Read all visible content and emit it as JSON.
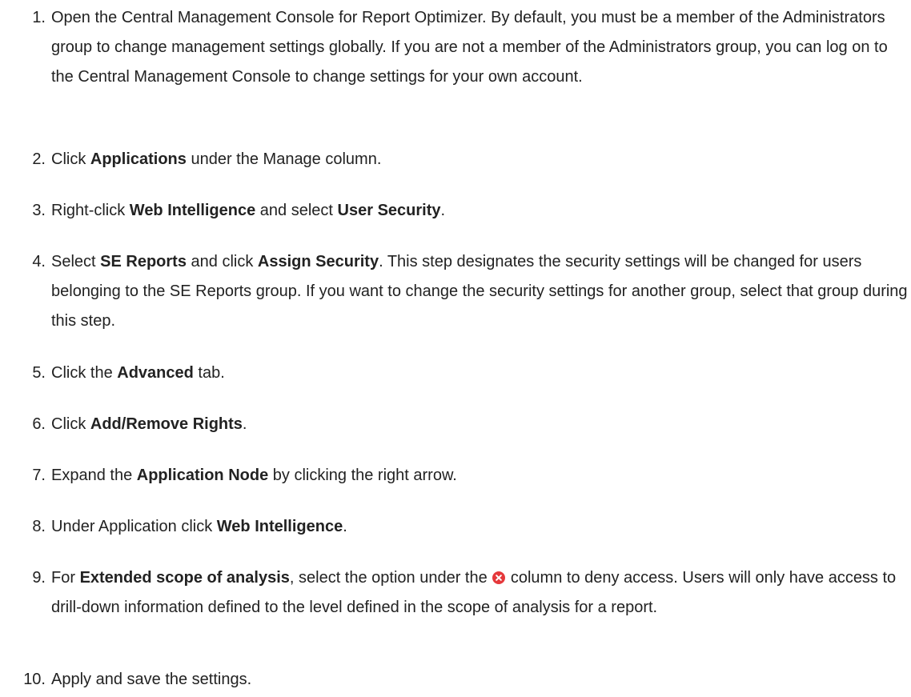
{
  "steps": [
    {
      "number": "1.",
      "text": "Open the Central Management Console for Report Optimizer. By default, you must be a member of the Administrators group to change management settings globally. If you are not a member of the Administrators group, you can log on to the Central Management Console to change settings for your own account."
    },
    {
      "number": "2.",
      "pre": "Click ",
      "bold": "Applications",
      "post": " under the Manage column."
    },
    {
      "number": "3.",
      "pre": "Right-click ",
      "bold1": "Web Intelligence",
      "mid": " and select ",
      "bold2": "User Security",
      "post": "."
    },
    {
      "number": "4.",
      "pre": "Select ",
      "bold1": "SE Reports",
      "mid": " and click ",
      "bold2": "Assign Security",
      "post": ". This step designates the security settings will be changed for users belonging to the SE Reports group. If you want to change the security settings for another group, select that group during this step."
    },
    {
      "number": "5.",
      "pre": "Click the ",
      "bold": "Advanced",
      "post": " tab."
    },
    {
      "number": "6.",
      "pre": "Click ",
      "bold": "Add/Remove Rights",
      "post": "."
    },
    {
      "number": "7.",
      "pre": "Expand the ",
      "bold": "Application Node",
      "post": " by clicking the right arrow."
    },
    {
      "number": "8.",
      "pre": "Under Application click ",
      "bold": "Web Intelligence",
      "post": "."
    },
    {
      "number": "9.",
      "pre": "For ",
      "bold": "Extended scope of analysis",
      "mid": ", select the option under the ",
      "icon": "deny-icon",
      "post": " column to deny access. Users will only have access to drill-down information defined to the level defined in the scope of analysis for a report."
    },
    {
      "number": "10.",
      "text": "Apply and save the settings."
    }
  ],
  "colors": {
    "text": "#222222",
    "deny_icon": "#e5383b"
  }
}
